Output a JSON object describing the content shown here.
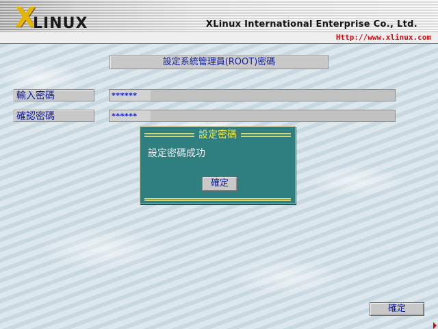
{
  "header": {
    "logo_x": "X",
    "logo_text": "LINUX",
    "company": "XLinux International Enterprise Co., Ltd.",
    "url": "Http://www.xlinux.com"
  },
  "main": {
    "title": "設定系統管理員(ROOT)密碼",
    "fields": [
      {
        "label": "輸入密碼",
        "value": "******"
      },
      {
        "label": "確認密碼",
        "value": "******"
      }
    ],
    "confirm_label": "確定"
  },
  "dialog": {
    "title": "設定密碼",
    "message": "設定密碼成功",
    "ok_label": "確定"
  },
  "colors": {
    "accent": "#1420a0",
    "dialog_bg": "#2f7f80",
    "dialog_title": "#f1e640",
    "url": "#d01010",
    "logo": "#e4b400"
  }
}
